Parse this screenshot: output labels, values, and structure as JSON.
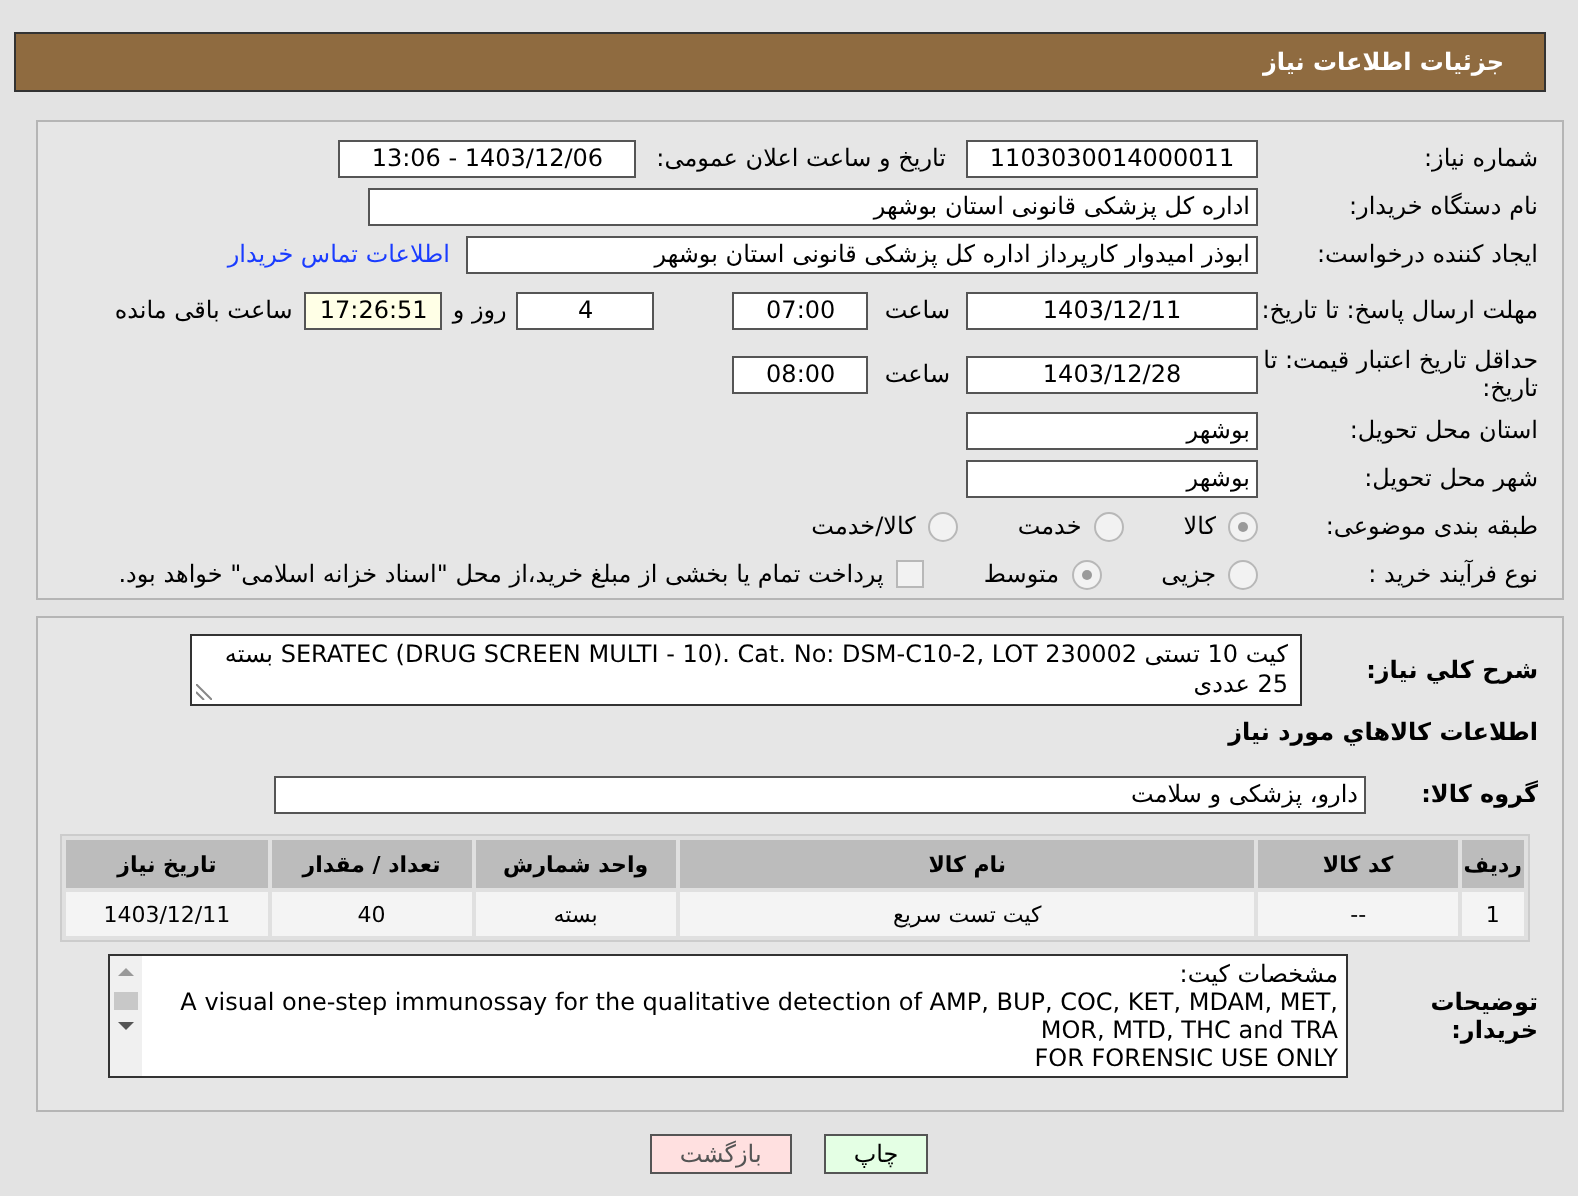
{
  "header": {
    "title": "جزئیات اطلاعات نیاز"
  },
  "details": {
    "need_number": {
      "label": "شماره نیاز:",
      "value": "1103030014000011"
    },
    "announce": {
      "label": "تاریخ و ساعت اعلان عمومی:",
      "value": "1403/12/06 - 13:06"
    },
    "buyer": {
      "label": "نام دستگاه خریدار:",
      "value": "اداره کل پزشکی قانونی استان بوشهر"
    },
    "creator": {
      "label": "ایجاد کننده درخواست:",
      "value": "ابوذر امیدوار کارپرداز اداره کل پزشکی قانونی استان بوشهر",
      "link": "اطلاعات تماس خریدار"
    },
    "deadline": {
      "label": "مهلت ارسال پاسخ: تا تاریخ:",
      "date": "1403/12/11",
      "time_label": "ساعت",
      "time": "07:00",
      "days": "4",
      "days_label": "روز و",
      "remaining": "17:26:51",
      "remaining_label": "ساعت باقی مانده"
    },
    "validity": {
      "label": "حداقل تاریخ اعتبار قیمت: تا تاریخ:",
      "date": "1403/12/28",
      "time_label": "ساعت",
      "time": "08:00"
    },
    "province": {
      "label": "استان محل تحویل:",
      "value": "بوشهر"
    },
    "city": {
      "label": "شهر محل تحویل:",
      "value": "بوشهر"
    },
    "category": {
      "label": "طبقه بندی موضوعی:",
      "options": [
        {
          "label": "کالا",
          "selected": true
        },
        {
          "label": "خدمت",
          "selected": false
        },
        {
          "label": "کالا/خدمت",
          "selected": false
        }
      ]
    },
    "process": {
      "label": "نوع فرآیند خرید :",
      "options": [
        {
          "label": "جزیی",
          "selected": false
        },
        {
          "label": "متوسط",
          "selected": true
        }
      ],
      "treasury": {
        "label": "پرداخت تمام یا بخشی از مبلغ خرید،از محل \"اسناد خزانه اسلامی\" خواهد بود.",
        "checked": false
      }
    }
  },
  "goods": {
    "summary": {
      "label": "شرح كلي نياز:",
      "value": "کیت 10 تستی SERATEC (DRUG SCREEN MULTI - 10). Cat. No: DSM-C10-2, LOT 230002 بسته 25 عددی"
    },
    "heading": "اطلاعات كالاهاي مورد نياز",
    "group": {
      "label": "گروه کالا:",
      "value": "دارو، پزشکی و سلامت"
    },
    "table": {
      "columns": [
        "ردیف",
        "کد کالا",
        "نام کالا",
        "واحد شمارش",
        "تعداد / مقدار",
        "تاریخ نیاز"
      ],
      "rows": [
        [
          "1",
          "--",
          "کیت تست سریع",
          "بسته",
          "40",
          "1403/12/11"
        ]
      ]
    },
    "buyer_notes": {
      "label": "توضیحات خریدار:",
      "lines": [
        "مشخصات کیت:",
        "A visual one-step immunossay for the qualitative detection of AMP, BUP, COC, KET, MDAM, MET, MOR, MTD, THC and TRA",
        "FOR FORENSIC USE ONLY"
      ]
    }
  },
  "buttons": [
    {
      "label": "چاپ",
      "kind": "print"
    },
    {
      "label": "بازگشت",
      "kind": "back"
    }
  ]
}
